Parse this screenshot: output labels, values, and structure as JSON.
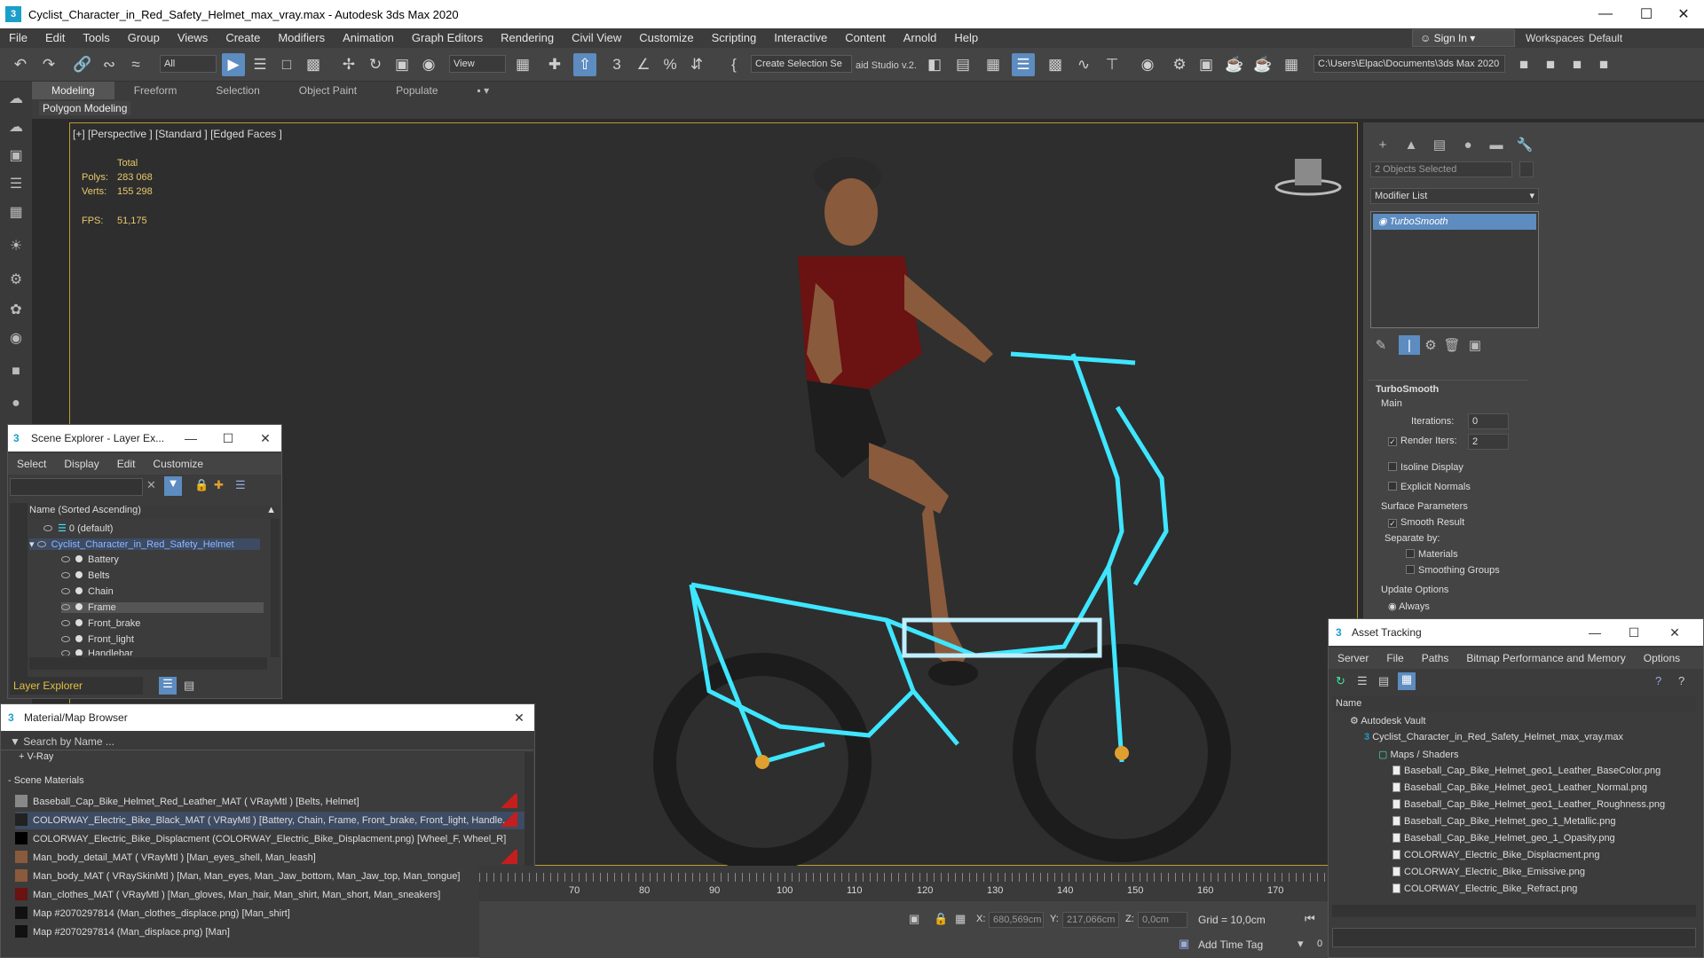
{
  "window": {
    "title": "Cyclist_Character_in_Red_Safety_Helmet_max_vray.max - Autodesk 3ds Max 2020",
    "app_icon": "3"
  },
  "menu": [
    "File",
    "Edit",
    "Tools",
    "Group",
    "Views",
    "Create",
    "Modifiers",
    "Animation",
    "Graph Editors",
    "Rendering",
    "Civil View",
    "Customize",
    "Scripting",
    "Interactive",
    "Content",
    "Arnold",
    "Help"
  ],
  "account": {
    "sign_in": "Sign In",
    "workspaces_label": "Workspaces:",
    "workspace": "Default"
  },
  "toolbar": {
    "selection_filter": "All",
    "ref_coord": "View",
    "create_selection_set": "Create Selection Se",
    "studio_label": "aid Studio v.2.",
    "project_path": "C:\\Users\\Elpac\\Documents\\3ds Max 2020"
  },
  "ribbon": {
    "tabs": [
      "Modeling",
      "Freeform",
      "Selection",
      "Object Paint",
      "Populate"
    ],
    "active_tab": "Modeling",
    "sub_label": "Polygon Modeling"
  },
  "viewport": {
    "label": "[+] [Perspective ] [Standard ] [Edged Faces ]",
    "stats": {
      "total_label": "Total",
      "polys_label": "Polys:",
      "polys": "283 068",
      "verts_label": "Verts:",
      "verts": "155 298",
      "fps_label": "FPS:",
      "fps": "51,175"
    }
  },
  "command_panel": {
    "selection_info": "2 Objects Selected",
    "modifier_list": "Modifier List",
    "modifier_stack": [
      "TurboSmooth"
    ],
    "rollout_title": "TurboSmooth",
    "main_label": "Main",
    "iterations_label": "Iterations:",
    "iterations": "0",
    "render_iters_label": "Render Iters:",
    "render_iters": "2",
    "isoline_display": "Isoline Display",
    "explicit_normals": "Explicit Normals",
    "surface_params": "Surface Parameters",
    "smooth_result": "Smooth Result",
    "separate_by": "Separate by:",
    "materials": "Materials",
    "smoothing_groups": "Smoothing Groups",
    "update_options": "Update Options",
    "always": "Always"
  },
  "scene_explorer": {
    "title": "Scene Explorer - Layer Ex...",
    "menu": [
      "Select",
      "Display",
      "Edit",
      "Customize"
    ],
    "column": "Name (Sorted Ascending)",
    "rows": [
      "0 (default)",
      "Cyclist_Character_in_Red_Safety_Helmet",
      "Battery",
      "Belts",
      "Chain",
      "Frame",
      "Front_brake",
      "Front_light",
      "Handlebar"
    ],
    "footer": "Layer Explorer"
  },
  "material_browser": {
    "title": "Material/Map Browser",
    "search_placeholder": "Search by Name ...",
    "vray_group": "+ V-Ray",
    "scene_group": "- Scene Materials",
    "items": [
      "Baseball_Cap_Bike_Helmet_Red_Leather_MAT ( VRayMtl ) [Belts, Helmet]",
      "COLORWAY_Electric_Bike_Black_MAT ( VRayMtl ) [Battery, Chain, Frame, Front_brake, Front_light, Handle...",
      "COLORWAY_Electric_Bike_Displacment (COLORWAY_Electric_Bike_Displacment.png) [Wheel_F, Wheel_R]",
      "Man_body_detail_MAT ( VRayMtl ) [Man_eyes_shell, Man_leash]",
      "Man_body_MAT ( VRaySkinMtl ) [Man, Man_eyes, Man_Jaw_bottom, Man_Jaw_top, Man_tongue]",
      "Man_clothes_MAT ( VRayMtl ) [Man_gloves, Man_hair, Man_shirt, Man_short, Man_sneakers]",
      "Map #2070297814 (Man_clothes_displace.png) [Man_shirt]",
      "Map #2070297814 (Man_displace.png) [Man]"
    ]
  },
  "asset_tracking": {
    "title": "Asset Tracking",
    "menu": [
      "Server",
      "File",
      "Paths",
      "Bitmap Performance and Memory",
      "Options"
    ],
    "column": "Name",
    "rows": [
      "Autodesk Vault",
      "Cyclist_Character_in_Red_Safety_Helmet_max_vray.max",
      "Maps / Shaders",
      "Baseball_Cap_Bike_Helmet_geo1_Leather_BaseColor.png",
      "Baseball_Cap_Bike_Helmet_geo1_Leather_Normal.png",
      "Baseball_Cap_Bike_Helmet_geo1_Leather_Roughness.png",
      "Baseball_Cap_Bike_Helmet_geo_1_Metallic.png",
      "Baseball_Cap_Bike_Helmet_geo_1_Opasity.png",
      "COLORWAY_Electric_Bike_Displacment.png",
      "COLORWAY_Electric_Bike_Emissive.png",
      "COLORWAY_Electric_Bike_Refract.png"
    ]
  },
  "timeline": {
    "ticks": [
      "70",
      "80",
      "90",
      "100",
      "110",
      "120",
      "130",
      "140",
      "150",
      "160",
      "170"
    ]
  },
  "status": {
    "x_label": "X:",
    "x": "680,569cm",
    "y_label": "Y:",
    "y": "217,066cm",
    "z_label": "Z:",
    "z": "0,0cm",
    "grid": "Grid = 10,0cm",
    "add_time_tag": "Add Time Tag",
    "frame": "0"
  },
  "colors": {
    "accent": "#5c8cc0",
    "viewport_border": "#b89c2f",
    "wire": "#3ee6ff",
    "stats": "#e8c96c"
  }
}
